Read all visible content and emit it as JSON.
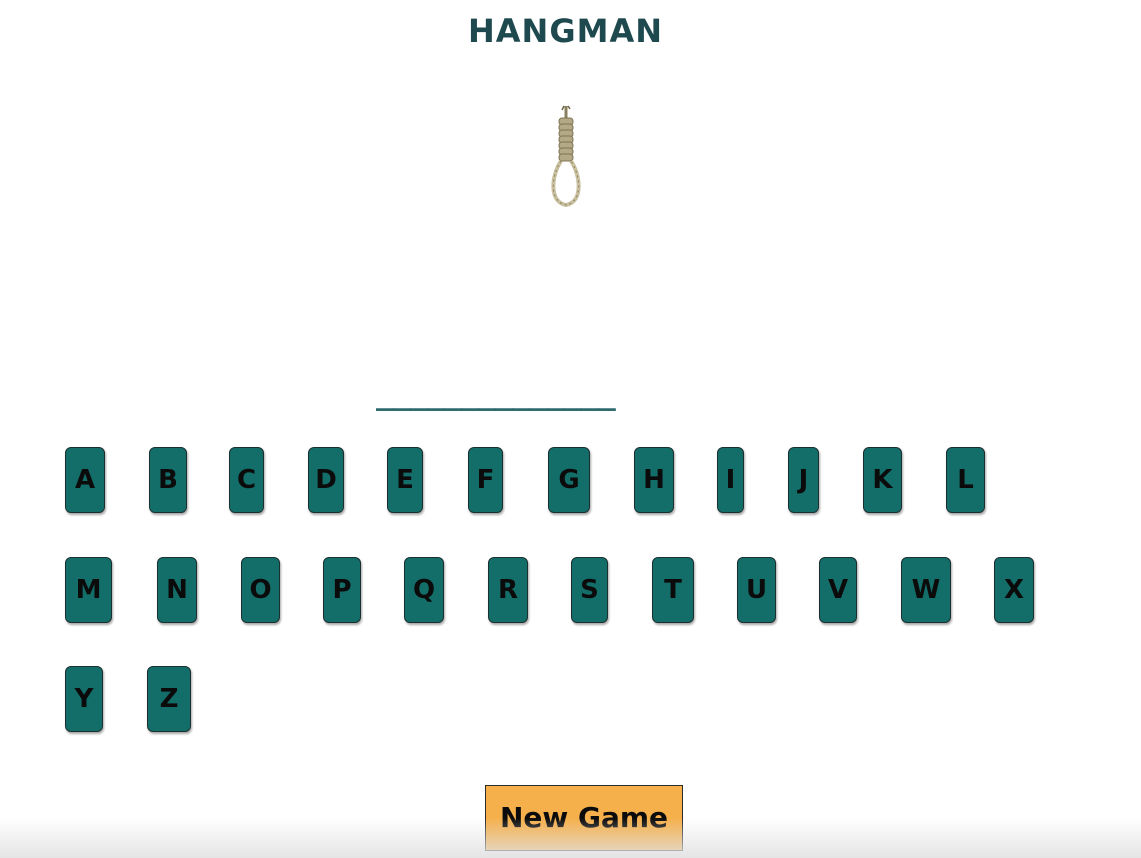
{
  "game": {
    "title": "HANGMAN",
    "word_display": "______________",
    "new_game_label": "New Game"
  },
  "keyboard": {
    "letters": [
      "A",
      "B",
      "C",
      "D",
      "E",
      "F",
      "G",
      "H",
      "I",
      "J",
      "K",
      "L",
      "M",
      "N",
      "O",
      "P",
      "Q",
      "R",
      "S",
      "T",
      "U",
      "V",
      "W",
      "X",
      "Y",
      "Z"
    ]
  },
  "colors": {
    "title": "#1e4a4f",
    "key_bg": "#136e6a",
    "new_game_bg": "#f5b04c",
    "word_dash": "#2f6a6e"
  },
  "icons": {
    "gallows": "noose-icon"
  }
}
